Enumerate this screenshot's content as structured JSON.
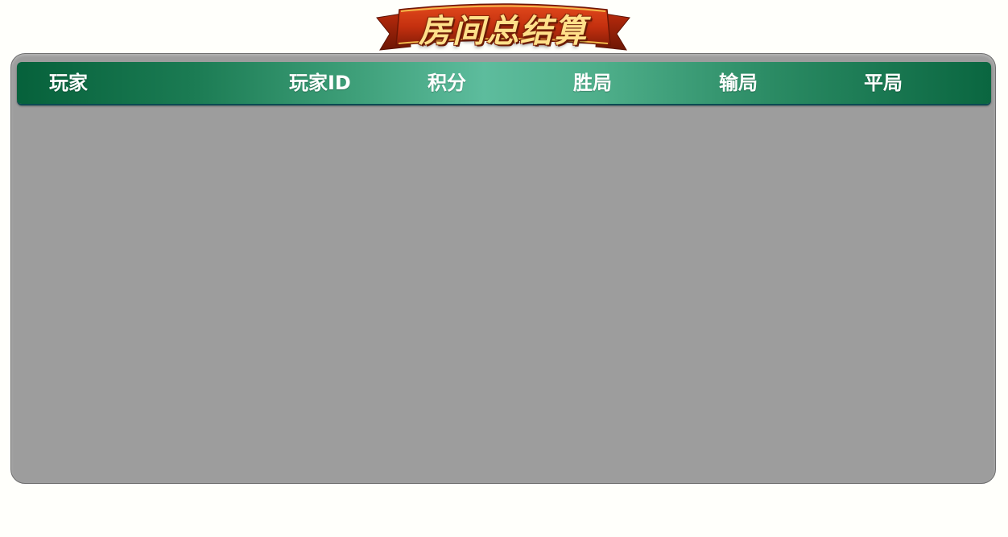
{
  "banner": {
    "title": "房间总结算"
  },
  "table": {
    "columns": [
      {
        "key": "player",
        "label": "玩家"
      },
      {
        "key": "player_id",
        "label": "玩家ID"
      },
      {
        "key": "score",
        "label": "积分"
      },
      {
        "key": "wins",
        "label": "胜局"
      },
      {
        "key": "losses",
        "label": "输局"
      },
      {
        "key": "draws",
        "label": "平局"
      }
    ],
    "rows": []
  },
  "colors": {
    "page_bg": "#fffffb",
    "panel_bg": "#9d9d9d",
    "header_dark": "#06613b",
    "header_light": "#5dbc9d",
    "banner_red": "#c4300f",
    "banner_gold": "#ffe08a"
  }
}
